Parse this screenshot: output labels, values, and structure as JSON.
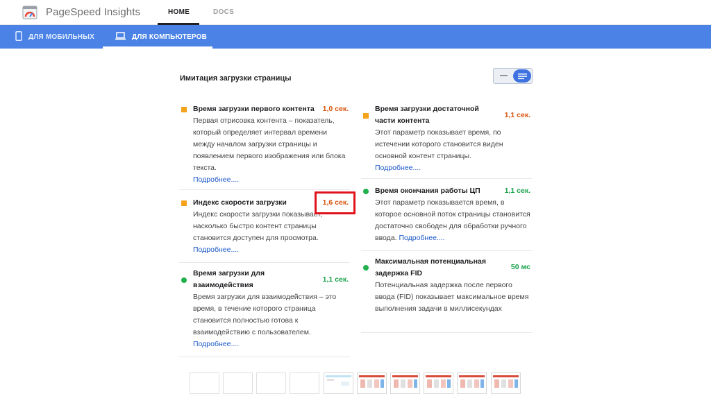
{
  "header": {
    "brand": "PageSpeed Insights",
    "nav": {
      "home": "HOME",
      "docs": "DOCS"
    }
  },
  "device_tabs": {
    "mobile": "ДЛЯ МОБИЛЬНЫХ",
    "desktop": "ДЛЯ КОМПЬЮТЕРОВ",
    "selected": "desktop"
  },
  "section": {
    "title": "Имитация загрузки страницы"
  },
  "metrics_left": [
    {
      "title": "Время загрузки первого контента",
      "value": "1,0 сек.",
      "status": "average",
      "desc": "Первая отрисовка контента – показатель, который определяет интервал времени между началом загрузки страницы и появлением первого изображения или блока текста.",
      "link": "Подробнее...."
    },
    {
      "title": "Индекс скорости загрузки",
      "value": "1,6 сек.",
      "status": "average",
      "desc": "Индекс скорости загрузки показывает, насколько быстро контент страницы становится доступен для просмотра.",
      "link": "Подробнее...."
    },
    {
      "title": "Время загрузки для взаимодействия",
      "value": "1,1 сек.",
      "status": "good",
      "desc": "Время загрузки для взаимодействия – это время, в течение которого страница становится полностью готова к взаимодействию с пользователем.",
      "link": "Подробнее...."
    }
  ],
  "metrics_right": [
    {
      "title": "Время загрузки достаточной части контента",
      "value": "1,1 сек.",
      "status": "average",
      "desc": "Этот параметр показывает время, по истечении которого становится виден основной контент страницы.",
      "link": "Подробнее...."
    },
    {
      "title": "Время окончания работы ЦП",
      "value": "1,1 сек.",
      "status": "good",
      "desc": "Этот параметр показывается время, в которое основной поток страницы становится достаточно свободен для обработки ручного ввода.",
      "link": "Подробнее...."
    },
    {
      "title": "Максимальная потенциальная задержка FID",
      "value": "50 мс",
      "status": "good",
      "desc": "Потенциальная задержка после первого ввода (FID) показывает максимальное время выполнения задачи в миллисекундах",
      "link": ""
    }
  ],
  "colors": {
    "accent_blue": "#4a82e6",
    "status_average": "#f4a31b",
    "status_good": "#23b14d",
    "highlight_red": "#e0121b"
  },
  "filmstrip": {
    "frames_total": 10,
    "frames_blank": 4
  }
}
